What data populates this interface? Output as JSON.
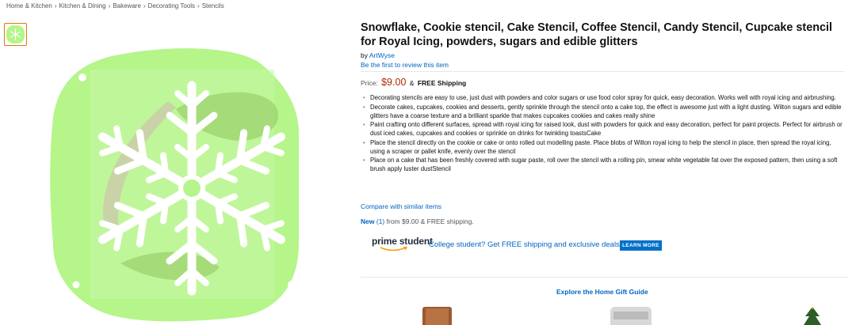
{
  "breadcrumb": [
    {
      "label": "Home & Kitchen"
    },
    {
      "label": "Kitchen & Dining"
    },
    {
      "label": "Bakeware"
    },
    {
      "label": "Decorating Tools"
    },
    {
      "label": "Stencils"
    }
  ],
  "breadcrumb_separator": "›",
  "product": {
    "title": "Snowflake, Cookie stencil, Cake Stencil, Coffee Stencil, Candy Stencil, Cupcake stencil for Royal Icing, powders, sugars and edible glitters",
    "by_label": "by",
    "brand": "ArtWyse",
    "review_link": "Be the first to review this item",
    "price_label": "Price:",
    "price": "$9.00",
    "price_amp": "&",
    "shipping": "FREE Shipping",
    "features": [
      "Decorating stencils are easy to use, just dust with powders and color sugars or use food color spray for quick, easy decoration. Works well with royal icing and airbrushing.",
      "Decorate cakes, cupcakes, cookies and desserts, gently sprinkle through the stencil onto a cake top, the effect is awesome just with a light dusting. Wilton sugars and edible glitters have a coarse texture and a brilliant sparkle that makes cupcakes cookies and cakes really shine",
      "Paint crafting onto different surfaces, spread with royal icing for raised look, dust with powders for quick and easy decoration, perfect for paint projects. Perfect for airbrush or dust iced cakes, cupcakes and cookies or sprinkle on drinks for twinkling toastsCake",
      "Place the stencil directly on the cookie or cake or onto rolled out modelling paste. Place blobs of Wilton royal icing to help the stencil in place, then spread the royal icing, using a scraper or pallet knife, evenly over the stencil",
      "Place on a cake that has been freshly covered with sugar paste, roll over the stencil with a rolling pin, smear white vegetable fat over the exposed pattern, then using a soft brush apply luster dustStencil"
    ],
    "compare_link": "Compare with similar items",
    "new_label": "New",
    "new_count": "(1)",
    "new_from": "from $9.00 & FREE shipping."
  },
  "prime_student": {
    "logo_word1": "prime",
    "logo_word2": "student",
    "promo": "College student? Get FREE shipping and exclusive deals",
    "button": "LEARN MORE",
    "accent": "#0070c9"
  },
  "gift_guide": {
    "label": "Explore the Home Gift Guide"
  },
  "colors": {
    "link": "#0066c0",
    "price": "#b12704",
    "stencil_green": "#b5f58a",
    "thumb_border": "#e77600"
  },
  "icons": {
    "thumbnail": "snowflake-stencil-thumbnail",
    "main": "snowflake-stencil-image",
    "prime_smile": "amazon-smile-icon"
  }
}
